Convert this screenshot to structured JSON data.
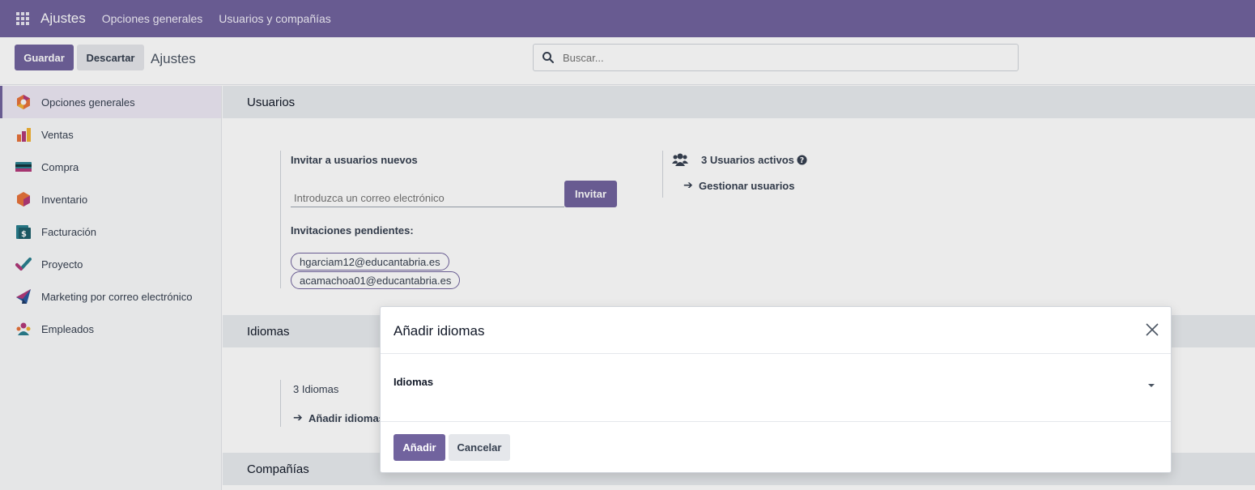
{
  "navbar": {
    "brand": "Ajustes",
    "links": [
      "Opciones generales",
      "Usuarios y compañías"
    ]
  },
  "control": {
    "save_label": "Guardar",
    "discard_label": "Descartar",
    "title": "Ajustes",
    "search_placeholder": "Buscar..."
  },
  "sidebar": {
    "items": [
      {
        "label": "Opciones generales",
        "icon": "settings-app-icon",
        "active": true
      },
      {
        "label": "Ventas",
        "icon": "sales-app-icon"
      },
      {
        "label": "Compra",
        "icon": "purchase-app-icon"
      },
      {
        "label": "Inventario",
        "icon": "inventory-app-icon"
      },
      {
        "label": "Facturación",
        "icon": "invoicing-app-icon"
      },
      {
        "label": "Proyecto",
        "icon": "project-app-icon"
      },
      {
        "label": "Marketing por correo electrónico",
        "icon": "email-marketing-app-icon"
      },
      {
        "label": "Empleados",
        "icon": "employees-app-icon"
      }
    ]
  },
  "users_section": {
    "title": "Usuarios",
    "invite_label": "Invitar a usuarios nuevos",
    "email_placeholder": "Introduzca un correo electrónico",
    "invite_button": "Invitar",
    "pending_label": "Invitaciones pendientes:",
    "pending": [
      "hgarciam12@educantabria.es",
      "acamachoa01@educantabria.es"
    ],
    "active_users": "3 Usuarios activos",
    "manage_users": "Gestionar usuarios"
  },
  "languages_section": {
    "title": "Idiomas",
    "count": "3 Idiomas",
    "add_link": "Añadir idiomas"
  },
  "companies_section": {
    "title": "Compañías"
  },
  "modal": {
    "title": "Añadir idiomas",
    "field_label": "Idiomas",
    "add_button": "Añadir",
    "cancel_button": "Cancelar"
  },
  "colors": {
    "brand": "#71639e",
    "section_bg": "#e9ecef"
  }
}
